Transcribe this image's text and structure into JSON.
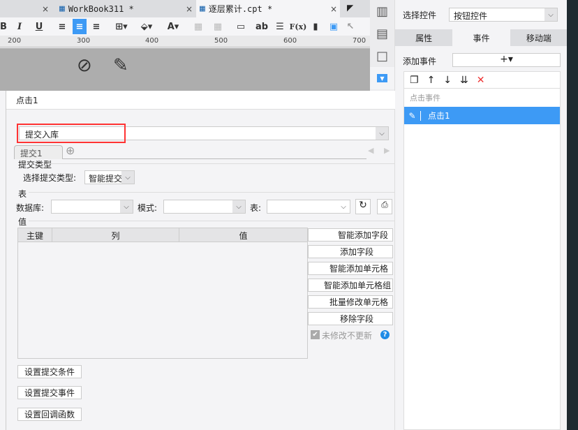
{
  "tabs": [
    {
      "label": "",
      "close": "×"
    },
    {
      "label": "WorkBook311 *",
      "close": "×"
    },
    {
      "label": "逐层累计.cpt *",
      "close": "×"
    }
  ],
  "toolbar": {
    "bold": "B",
    "italic": "I",
    "underline": "U",
    "text_tool": "ab",
    "formula": "F(x)"
  },
  "ruler": [
    "200",
    "300",
    "400",
    "500",
    "600",
    "700"
  ],
  "right_panel": {
    "select_label": "选择控件",
    "select_value": "按钮控件",
    "tabs": [
      "属性",
      "事件",
      "移动端"
    ],
    "active_tab": 1,
    "add_event_label": "添加事件",
    "add_event_btn": "+▾",
    "group_label": "点击事件",
    "events": [
      "点击1"
    ]
  },
  "dialog": {
    "title": "点击1",
    "action_value": "提交入库",
    "sub_tab": "提交1",
    "submit_type_section": "提交类型",
    "submit_type_label": "选择提交类型:",
    "submit_type_value": "智能提交",
    "table_section": "表",
    "db_label": "数据库:",
    "schema_label": "模式:",
    "table_label": "表:",
    "value_section": "值",
    "columns": [
      "主键",
      "列",
      "值"
    ],
    "side_buttons": [
      "智能添加字段",
      "添加字段",
      "智能添加单元格",
      "智能添加单元格组",
      "批量修改单元格",
      "移除字段"
    ],
    "no_update_label": "未修改不更新",
    "no_update_checked": true,
    "bottom_buttons": [
      "设置提交条件",
      "设置提交事件",
      "设置回调函数"
    ]
  },
  "colors": {
    "accent": "#3d9af5",
    "highlight": "#ff3333"
  }
}
